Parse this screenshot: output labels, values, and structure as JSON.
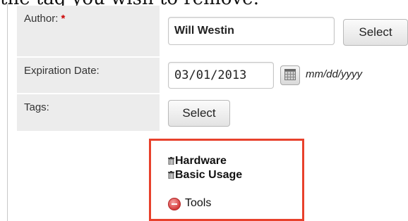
{
  "intro_text": "the tag you wish to remove:",
  "form": {
    "author": {
      "label": "Author:",
      "required_mark": "*",
      "value": "Will Westin",
      "select_label": "Select"
    },
    "expiration": {
      "label": "Expiration Date:",
      "value": "03/01/2013",
      "format_hint": "mm/dd/yyyy",
      "calendar_icon": "calendar-icon"
    },
    "tags": {
      "label": "Tags:",
      "select_label": "Select",
      "items": [
        {
          "name": "Hardware",
          "icon": "trash-icon"
        },
        {
          "name": "Basic Usage",
          "icon": "trash-icon"
        }
      ],
      "removed": {
        "name": "Tools",
        "icon": "remove-icon"
      }
    }
  },
  "colors": {
    "highlight_border": "#e8412c",
    "label_background": "#ececec",
    "required": "#cc0000"
  }
}
